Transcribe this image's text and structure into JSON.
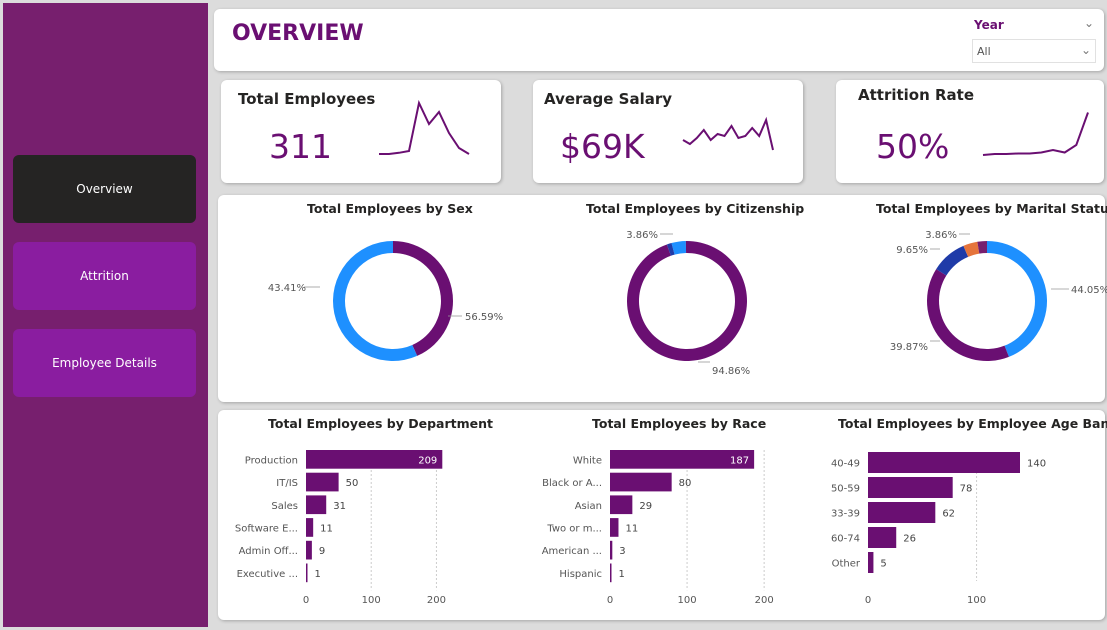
{
  "nav": {
    "items": [
      "Overview",
      "Attrition",
      "Employee Details"
    ]
  },
  "header": {
    "title": "OVERVIEW",
    "slicer_label": "Year",
    "slicer_value": "All"
  },
  "kpis": [
    {
      "title": "Total Employees",
      "value": "311"
    },
    {
      "title": "Average Salary",
      "value": "$69K"
    },
    {
      "title": "Attrition Rate",
      "value": "50%"
    }
  ],
  "colors": {
    "purple": "#6a0f72",
    "blue": "#1e90ff",
    "navy": "#1f3ba8",
    "orange": "#e5743c",
    "accent": "#8a1da0"
  },
  "chart_data": [
    {
      "type": "pie",
      "title": "Total Employees by Sex",
      "labels": [
        "43.41%",
        "56.59%"
      ],
      "values": [
        43.41,
        56.59
      ],
      "colors": [
        "#6a0f72",
        "#1e90ff"
      ]
    },
    {
      "type": "pie",
      "title": "Total Employees by Citizenship",
      "labels": [
        "3.86%",
        "94.86%"
      ],
      "values": [
        3.86,
        94.86,
        1.28
      ],
      "colors": [
        "#1e90ff",
        "#6a0f72",
        "#1f3ba8"
      ]
    },
    {
      "type": "pie",
      "title": "Total Employees by Marital Status",
      "labels": [
        "3.86%",
        "9.65%",
        "44.05%",
        "39.87%"
      ],
      "values": [
        44.05,
        39.87,
        9.65,
        3.86,
        2.57
      ],
      "colors": [
        "#1e90ff",
        "#6a0f72",
        "#1f3ba8",
        "#e5743c",
        "#771f6e"
      ]
    },
    {
      "type": "bar",
      "title": "Total Employees by Department",
      "categories": [
        "Production",
        "IT/IS",
        "Sales",
        "Software E...",
        "Admin Off...",
        "Executive ..."
      ],
      "values": [
        209,
        50,
        31,
        11,
        9,
        1
      ],
      "ticks": [
        0,
        100,
        200
      ],
      "xlim": [
        0,
        230
      ]
    },
    {
      "type": "bar",
      "title": "Total Employees by Race",
      "categories": [
        "White",
        "Black or A...",
        "Asian",
        "Two or m...",
        "American ...",
        "Hispanic"
      ],
      "values": [
        187,
        80,
        29,
        11,
        3,
        1
      ],
      "ticks": [
        0,
        100,
        200
      ],
      "xlim": [
        0,
        205
      ]
    },
    {
      "type": "bar",
      "title": "Total Employees by Employee Age Band",
      "categories": [
        "40-49",
        "50-59",
        "33-39",
        "60-74",
        "Other"
      ],
      "values": [
        140,
        78,
        62,
        26,
        5
      ],
      "ticks": [
        0,
        100
      ],
      "xlim": [
        0,
        175
      ]
    }
  ],
  "sparklines": [
    [
      0.1,
      0.1,
      0.12,
      0.15,
      0.95,
      0.6,
      0.8,
      0.45,
      0.2,
      0.1
    ],
    [
      0.45,
      0.35,
      0.5,
      0.7,
      0.45,
      0.6,
      0.55,
      0.8,
      0.5,
      0.55,
      0.75,
      0.55,
      0.95,
      0.2
    ],
    [
      0.1,
      0.12,
      0.12,
      0.13,
      0.13,
      0.15,
      0.2,
      0.15,
      0.3,
      0.95
    ]
  ]
}
